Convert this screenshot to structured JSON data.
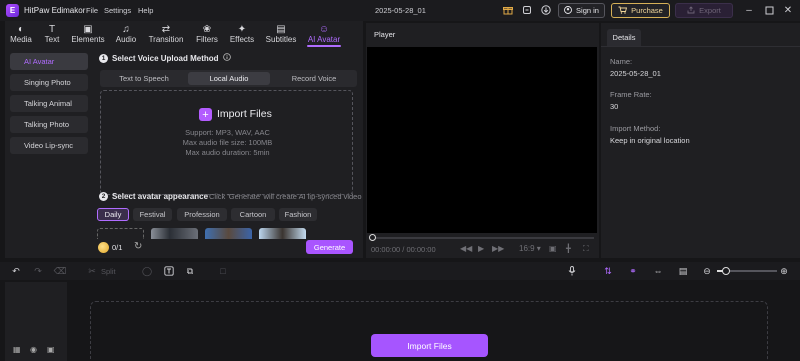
{
  "titlebar": {
    "app_name": "HitPaw Edimakor",
    "menus": [
      "File",
      "Settings",
      "Help"
    ],
    "project_name": "2025-05-28_01",
    "sign_in": "Sign in",
    "purchase": "Purchase",
    "export": "Export"
  },
  "toolbar": {
    "items": [
      {
        "label": "Media",
        "icon": "media-icon"
      },
      {
        "label": "Text",
        "icon": "text-icon"
      },
      {
        "label": "Elements",
        "icon": "elements-icon"
      },
      {
        "label": "Audio",
        "icon": "audio-icon"
      },
      {
        "label": "Transition",
        "icon": "transition-icon"
      },
      {
        "label": "Filters",
        "icon": "filters-icon"
      },
      {
        "label": "Effects",
        "icon": "effects-icon"
      },
      {
        "label": "Subtitles",
        "icon": "subtitles-icon"
      },
      {
        "label": "AI Avatar",
        "icon": "ai-avatar-icon",
        "active": true
      }
    ]
  },
  "sidebar": {
    "items": [
      {
        "label": "AI Avatar",
        "active": true
      },
      {
        "label": "Singing Photo"
      },
      {
        "label": "Talking Animal"
      },
      {
        "label": "Talking Photo"
      },
      {
        "label": "Video Lip-sync"
      }
    ]
  },
  "upload": {
    "step_number": "1",
    "title": "Select Voice Upload Method",
    "tabs": [
      "Text to Speech",
      "Local Audio",
      "Record Voice"
    ],
    "active_tab": "Local Audio",
    "import_label": "Import Files",
    "support_lines": [
      "Support: MP3, WAV, AAC",
      "Max audio file size: 100MB",
      "Max audio duration: 5min"
    ]
  },
  "avatar": {
    "step_number": "2",
    "title": "Select avatar appearance",
    "hint": "Click 'Generate' will create AI lip-synced video",
    "categories": [
      "Daily",
      "Festival",
      "Profession",
      "Cartoon",
      "Fashion"
    ],
    "active_category": "Daily",
    "credits": "0/1",
    "generate": "Generate"
  },
  "player": {
    "title": "Player",
    "timecode": "00:00:00 / 00:00:00",
    "aspect": "16:9"
  },
  "details": {
    "tab": "Details",
    "name_label": "Name:",
    "name_value": "2025-05-28_01",
    "frame_rate_label": "Frame Rate:",
    "frame_rate_value": "30",
    "import_method_label": "Import Method:",
    "import_method_value": "Keep in original location"
  },
  "timeline": {
    "split": "Split",
    "import_button": "Import Files",
    "zoom_level": 0.1
  },
  "colors": {
    "accent": "#a955ff",
    "panel": "#1f1f22",
    "background": "#161618",
    "purchase": "#d6b057"
  }
}
